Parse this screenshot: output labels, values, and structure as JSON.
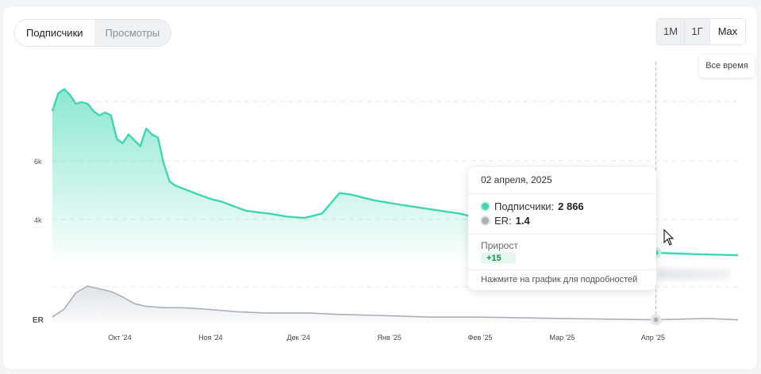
{
  "tabs": {
    "subscribers": "Подписчики",
    "views": "Просмотры"
  },
  "range": {
    "m1": "1М",
    "y1": "1Г",
    "max": "Max",
    "max_hint": "Все время"
  },
  "tooltip": {
    "date": "02 апреля, 2025",
    "subscribers_label": "Подписчики:",
    "subscribers_value": "2 866",
    "er_label": "ER:",
    "er_value": "1.4",
    "growth_label": "Прирост",
    "growth_value": "+15",
    "note": "Нажмите на график для подробностей"
  },
  "colors": {
    "subscribers": "#3dd8b2",
    "er": "#aab0b8",
    "grid": "#e6e8eb"
  },
  "chart_data": [
    {
      "type": "area",
      "name": "subscribers",
      "grid": true,
      "y_ticks": [
        {
          "label": "6k",
          "value": 6000
        },
        {
          "label": "4k",
          "value": 4000
        }
      ],
      "x_ticks": [
        "Окт '24",
        "Ноя '24",
        "Дек '24",
        "Янв '25",
        "Фев '25",
        "Мар '25",
        "Апр '25"
      ],
      "x": [
        "2024-09-08",
        "2024-09-10",
        "2024-09-12",
        "2024-09-14",
        "2024-09-16",
        "2024-09-18",
        "2024-09-20",
        "2024-09-22",
        "2024-09-24",
        "2024-09-26",
        "2024-09-28",
        "2024-09-30",
        "2024-10-02",
        "2024-10-04",
        "2024-10-06",
        "2024-10-08",
        "2024-10-10",
        "2024-10-12",
        "2024-10-14",
        "2024-10-16",
        "2024-10-18",
        "2024-10-20",
        "2024-10-24",
        "2024-10-28",
        "2024-11-01",
        "2024-11-05",
        "2024-11-09",
        "2024-11-13",
        "2024-11-17",
        "2024-11-21",
        "2024-11-27",
        "2024-12-03",
        "2024-12-09",
        "2024-12-12",
        "2024-12-15",
        "2024-12-19",
        "2024-12-23",
        "2024-12-27",
        "2025-01-05",
        "2025-01-15",
        "2025-01-25",
        "2025-02-05",
        "2025-02-15",
        "2025-02-25",
        "2025-03-10",
        "2025-03-20",
        "2025-04-02",
        "2025-04-15",
        "2025-04-30"
      ],
      "values": [
        7700,
        8300,
        8450,
        8250,
        7950,
        8000,
        7950,
        7700,
        7550,
        7650,
        7550,
        6750,
        6600,
        6900,
        6700,
        6500,
        7100,
        6900,
        6800,
        5900,
        5300,
        5150,
        5000,
        4850,
        4700,
        4600,
        4450,
        4300,
        4250,
        4200,
        4100,
        4050,
        4200,
        4550,
        4900,
        4850,
        4750,
        4650,
        4500,
        4350,
        4200,
        3950,
        3550,
        3150,
        3000,
        2900,
        2866,
        2820,
        2780
      ]
    },
    {
      "type": "area",
      "name": "ER",
      "y_label": "ER",
      "x": [
        "2024-09-08",
        "2024-09-12",
        "2024-09-16",
        "2024-09-20",
        "2024-09-24",
        "2024-09-28",
        "2024-10-02",
        "2024-10-06",
        "2024-10-10",
        "2024-10-16",
        "2024-10-22",
        "2024-10-30",
        "2024-11-10",
        "2024-11-20",
        "2024-11-30",
        "2024-12-05",
        "2024-12-15",
        "2025-01-01",
        "2025-01-15",
        "2025-02-01",
        "2025-03-01",
        "2025-04-02",
        "2025-04-20",
        "2025-04-30"
      ],
      "values": [
        1.6,
        2.2,
        3.4,
        3.9,
        3.7,
        3.5,
        3.1,
        2.6,
        2.4,
        2.3,
        2.3,
        2.2,
        2.0,
        1.9,
        1.9,
        1.9,
        1.8,
        1.7,
        1.6,
        1.6,
        1.5,
        1.4,
        1.5,
        1.4
      ]
    }
  ]
}
